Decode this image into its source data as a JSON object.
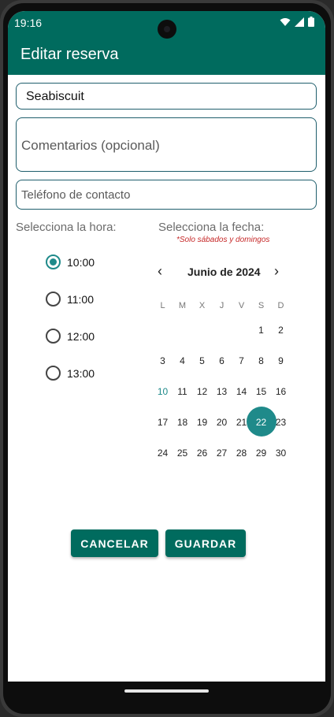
{
  "status_bar": {
    "time": "19:16"
  },
  "app_bar": {
    "title": "Editar reserva"
  },
  "form": {
    "name_value": "Seabiscuit",
    "comments_placeholder": "Comentarios (opcional)",
    "phone_placeholder": "Teléfono de contacto"
  },
  "time_section": {
    "label": "Selecciona la hora:",
    "options": [
      "10:00",
      "11:00",
      "12:00",
      "13:00"
    ],
    "selected": "10:00"
  },
  "date_section": {
    "label": "Selecciona la fecha:",
    "note": "*Solo sábados y domingos",
    "month_label": "Junio de 2024",
    "prev_icon": "chevron-left-icon",
    "next_icon": "chevron-right-icon",
    "weekdays": [
      "L",
      "M",
      "X",
      "J",
      "V",
      "S",
      "D"
    ],
    "weeks": [
      [
        "",
        "",
        "",
        "",
        "",
        "1",
        "2"
      ],
      [
        "3",
        "4",
        "5",
        "6",
        "7",
        "8",
        "9"
      ],
      [
        "10",
        "11",
        "12",
        "13",
        "14",
        "15",
        "16"
      ],
      [
        "17",
        "18",
        "19",
        "20",
        "21",
        "22",
        "23"
      ],
      [
        "24",
        "25",
        "26",
        "27",
        "28",
        "29",
        "30"
      ]
    ],
    "today": "10",
    "selected": "22"
  },
  "buttons": {
    "cancel": "CANCELAR",
    "save": "GUARDAR"
  },
  "colors": {
    "primary": "#006b5e",
    "accent": "#1f8a8a",
    "note_red": "#c62828"
  }
}
